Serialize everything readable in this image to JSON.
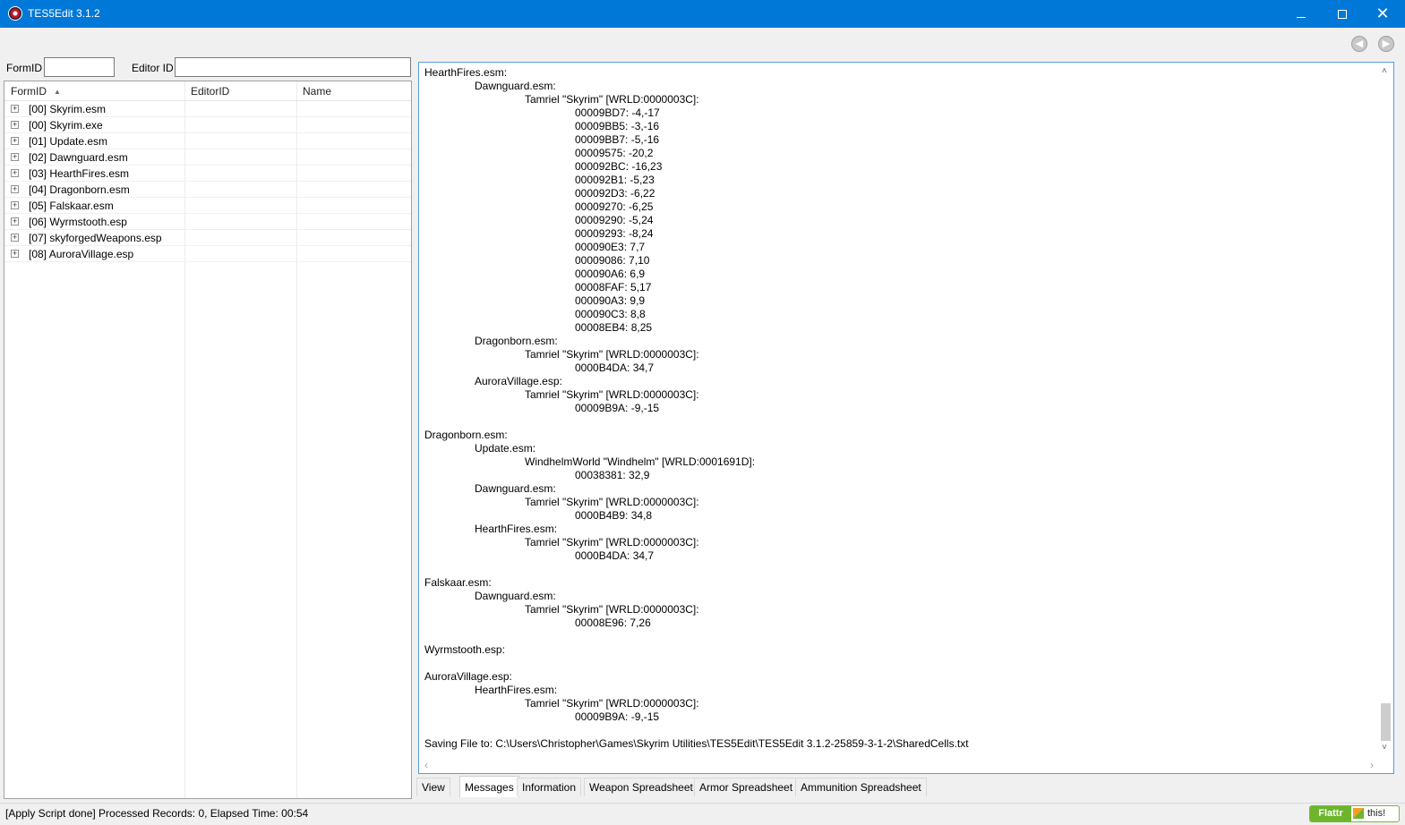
{
  "window": {
    "title": "TES5Edit 3.1.2",
    "minimize": "—",
    "close": "✕"
  },
  "nav": {
    "back_icon": "◀",
    "forward_icon": "▶"
  },
  "filter": {
    "formid_label": "FormID",
    "formid_value": "",
    "editorid_label": "Editor ID",
    "editorid_value": ""
  },
  "tree": {
    "columns": {
      "formid": "FormID",
      "editorid": "EditorID",
      "name": "Name",
      "sort_icon": "▲"
    },
    "expander": "+",
    "items": [
      "[00] Skyrim.esm",
      "[00] Skyrim.exe",
      "[01] Update.esm",
      "[02] Dawnguard.esm",
      "[03] HearthFires.esm",
      "[04] Dragonborn.esm",
      "[05] Falskaar.esm",
      "[06] Wyrmstooth.esp",
      "[07] skyforgedWeapons.esp",
      "[08] AuroraVillage.esp"
    ]
  },
  "messages": {
    "lines": [
      {
        "indent": 0,
        "text": "HearthFires.esm:"
      },
      {
        "indent": 1,
        "text": "Dawnguard.esm:"
      },
      {
        "indent": 2,
        "text": "Tamriel \"Skyrim\" [WRLD:0000003C]:"
      },
      {
        "indent": 3,
        "text": "00009BD7: -4,-17"
      },
      {
        "indent": 3,
        "text": "00009BB5: -3,-16"
      },
      {
        "indent": 3,
        "text": "00009BB7: -5,-16"
      },
      {
        "indent": 3,
        "text": "00009575: -20,2"
      },
      {
        "indent": 3,
        "text": "000092BC: -16,23"
      },
      {
        "indent": 3,
        "text": "000092B1: -5,23"
      },
      {
        "indent": 3,
        "text": "000092D3: -6,22"
      },
      {
        "indent": 3,
        "text": "00009270: -6,25"
      },
      {
        "indent": 3,
        "text": "00009290: -5,24"
      },
      {
        "indent": 3,
        "text": "00009293: -8,24"
      },
      {
        "indent": 3,
        "text": "000090E3: 7,7"
      },
      {
        "indent": 3,
        "text": "00009086: 7,10"
      },
      {
        "indent": 3,
        "text": "000090A6: 6,9"
      },
      {
        "indent": 3,
        "text": "00008FAF: 5,17"
      },
      {
        "indent": 3,
        "text": "000090A3: 9,9"
      },
      {
        "indent": 3,
        "text": "000090C3: 8,8"
      },
      {
        "indent": 3,
        "text": "00008EB4: 8,25"
      },
      {
        "indent": 1,
        "text": "Dragonborn.esm:"
      },
      {
        "indent": 2,
        "text": "Tamriel \"Skyrim\" [WRLD:0000003C]:"
      },
      {
        "indent": 3,
        "text": "0000B4DA: 34,7"
      },
      {
        "indent": 1,
        "text": "AuroraVillage.esp:"
      },
      {
        "indent": 2,
        "text": "Tamriel \"Skyrim\" [WRLD:0000003C]:"
      },
      {
        "indent": 3,
        "text": "00009B9A: -9,-15"
      },
      {
        "indent": 0,
        "text": ""
      },
      {
        "indent": 0,
        "text": "Dragonborn.esm:"
      },
      {
        "indent": 1,
        "text": "Update.esm:"
      },
      {
        "indent": 2,
        "text": "WindhelmWorld \"Windhelm\" [WRLD:0001691D]:"
      },
      {
        "indent": 3,
        "text": "00038381: 32,9"
      },
      {
        "indent": 1,
        "text": "Dawnguard.esm:"
      },
      {
        "indent": 2,
        "text": "Tamriel \"Skyrim\" [WRLD:0000003C]:"
      },
      {
        "indent": 3,
        "text": "0000B4B9: 34,8"
      },
      {
        "indent": 1,
        "text": "HearthFires.esm:"
      },
      {
        "indent": 2,
        "text": "Tamriel \"Skyrim\" [WRLD:0000003C]:"
      },
      {
        "indent": 3,
        "text": "0000B4DA: 34,7"
      },
      {
        "indent": 0,
        "text": ""
      },
      {
        "indent": 0,
        "text": "Falskaar.esm:"
      },
      {
        "indent": 1,
        "text": "Dawnguard.esm:"
      },
      {
        "indent": 2,
        "text": "Tamriel \"Skyrim\" [WRLD:0000003C]:"
      },
      {
        "indent": 3,
        "text": "00008E96: 7,26"
      },
      {
        "indent": 0,
        "text": ""
      },
      {
        "indent": 0,
        "text": "Wyrmstooth.esp:"
      },
      {
        "indent": 0,
        "text": ""
      },
      {
        "indent": 0,
        "text": "AuroraVillage.esp:"
      },
      {
        "indent": 1,
        "text": "HearthFires.esm:"
      },
      {
        "indent": 2,
        "text": "Tamriel \"Skyrim\" [WRLD:0000003C]:"
      },
      {
        "indent": 3,
        "text": "00009B9A: -9,-15"
      },
      {
        "indent": 0,
        "text": ""
      },
      {
        "indent": 0,
        "text": "Saving File to: C:\\Users\\Christopher\\Games\\Skyrim Utilities\\TES5Edit\\TES5Edit 3.1.2-25859-3-1-2\\SharedCells.txt"
      }
    ],
    "scroll_up": "˄",
    "scroll_down": "˅",
    "scroll_left": "‹",
    "scroll_right": "›"
  },
  "tabs": [
    {
      "label": "View",
      "active": false
    },
    {
      "label": "Messages",
      "active": true
    },
    {
      "label": "Information",
      "active": false
    },
    {
      "label": "Weapon Spreadsheet",
      "active": false
    },
    {
      "label": "Armor Spreadsheet",
      "active": false
    },
    {
      "label": "Ammunition Spreadsheet",
      "active": false
    }
  ],
  "status": {
    "text": "[Apply Script done]  Processed Records: 0, Elapsed Time: 00:54",
    "flattr_label": "Flattr",
    "flattr_this": "this!"
  }
}
